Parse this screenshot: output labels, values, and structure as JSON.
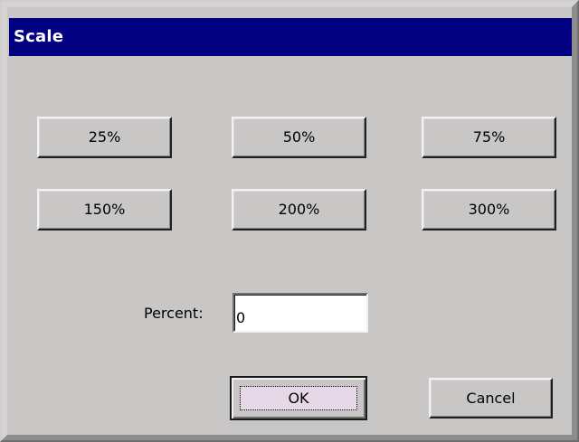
{
  "dialog": {
    "title": "Scale"
  },
  "presets": [
    {
      "label": "25%"
    },
    {
      "label": "50%"
    },
    {
      "label": "75%"
    },
    {
      "label": "150%"
    },
    {
      "label": "200%"
    },
    {
      "label": "300%"
    }
  ],
  "percent": {
    "label": "Percent:",
    "value": "0"
  },
  "actions": {
    "ok_label": "OK",
    "cancel_label": "Cancel"
  },
  "colors": {
    "titlebar": "#000080",
    "dialog_face": "#c9c6c6",
    "ok_focus": "#e6d8e6"
  }
}
